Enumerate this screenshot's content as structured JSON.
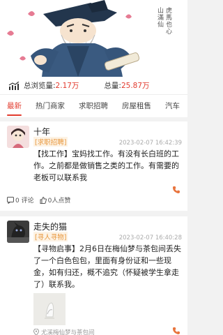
{
  "banner": {
    "seal_text": "虎馬也心",
    "seal_line2": "山滿仙"
  },
  "stats": {
    "views_label": "总浏览量:",
    "views_value": "2.17万",
    "total_label": "总量:",
    "total_value": "25.87万"
  },
  "tabs": [
    "最新",
    "热门商家",
    "求职招聘",
    "房屋租售",
    "汽车"
  ],
  "posts": [
    {
      "name": "十年",
      "tag": "[求职招聘]",
      "time": "2023-02-07 16:42:39",
      "content": "【找工作】宝妈找工作。有没有长白班的工作。之前都是做销售之类的工作。有需要的老板可以联系我",
      "comments": "0 评论",
      "likes": "0人点赞"
    },
    {
      "name": "走失的猫",
      "tag": "[寻人寻物]",
      "time": "2023-02-07 16:40:28",
      "content": "【寻物启事】2月6日在梅仙梦与茶包间丢失了一个白色包包，里面有身份证和一些现金，如有归还，概不追究（怀疑被学生拿走了）联系我。",
      "location": "尤溪梅仙梦与茶包间"
    }
  ],
  "colors": {
    "accent": "#e23b2e",
    "tag": "#e8973d"
  }
}
